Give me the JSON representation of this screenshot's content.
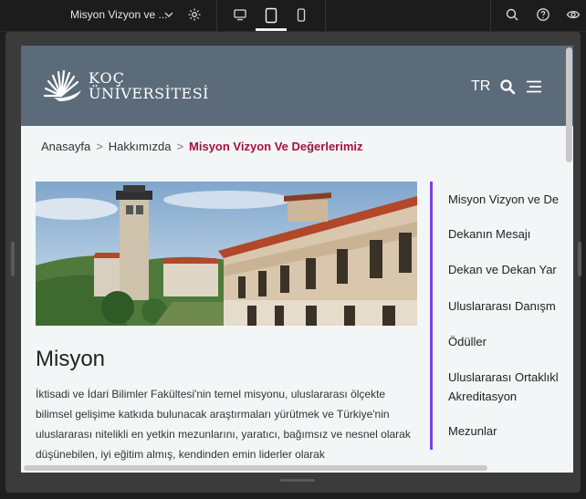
{
  "toolbar": {
    "page_title": "Misyon Vizyon ve ...",
    "icons": [
      "chevron-down-icon",
      "gear-icon",
      "desktop-icon",
      "tablet-icon",
      "mobile-icon",
      "search-icon",
      "help-icon",
      "eye-icon"
    ]
  },
  "header": {
    "logo_line1": "KOÇ",
    "logo_line2": "ÜNİVERSİTESİ",
    "lang": "TR"
  },
  "breadcrumb": {
    "items": [
      "Anasayfa",
      "Hakkımızda",
      "Misyon Vizyon Ve Değerlerimiz"
    ],
    "separator": ">"
  },
  "main": {
    "section_title": "Misyon",
    "paragraph": "İktisadi ve İdari Bilimler Fakültesi'nin temel misyonu, uluslararası ölçekte bilimsel gelişime katkıda bulunacak araştırmaları yürütmek ve Türkiye'nin uluslararası nitelikli en yetkin mezunlarını, yaratıcı, bağımsız ve nesnel olarak düşünebilen, iyi eğitim almış, kendinden emin liderler olarak"
  },
  "sidenav": {
    "items": [
      "Misyon Vizyon ve De",
      "Dekanın Mesajı",
      "Dekan ve Dekan Yar",
      "Uluslararası Danışm",
      "Ödüller",
      "Uluslararası Ortaklıkl",
      "Akreditasyon",
      "Mezunlar"
    ]
  },
  "colors": {
    "header_bg": "#5b6b7a",
    "accent_red": "#a4123f",
    "sidenav_border": "#7b3fe4"
  }
}
